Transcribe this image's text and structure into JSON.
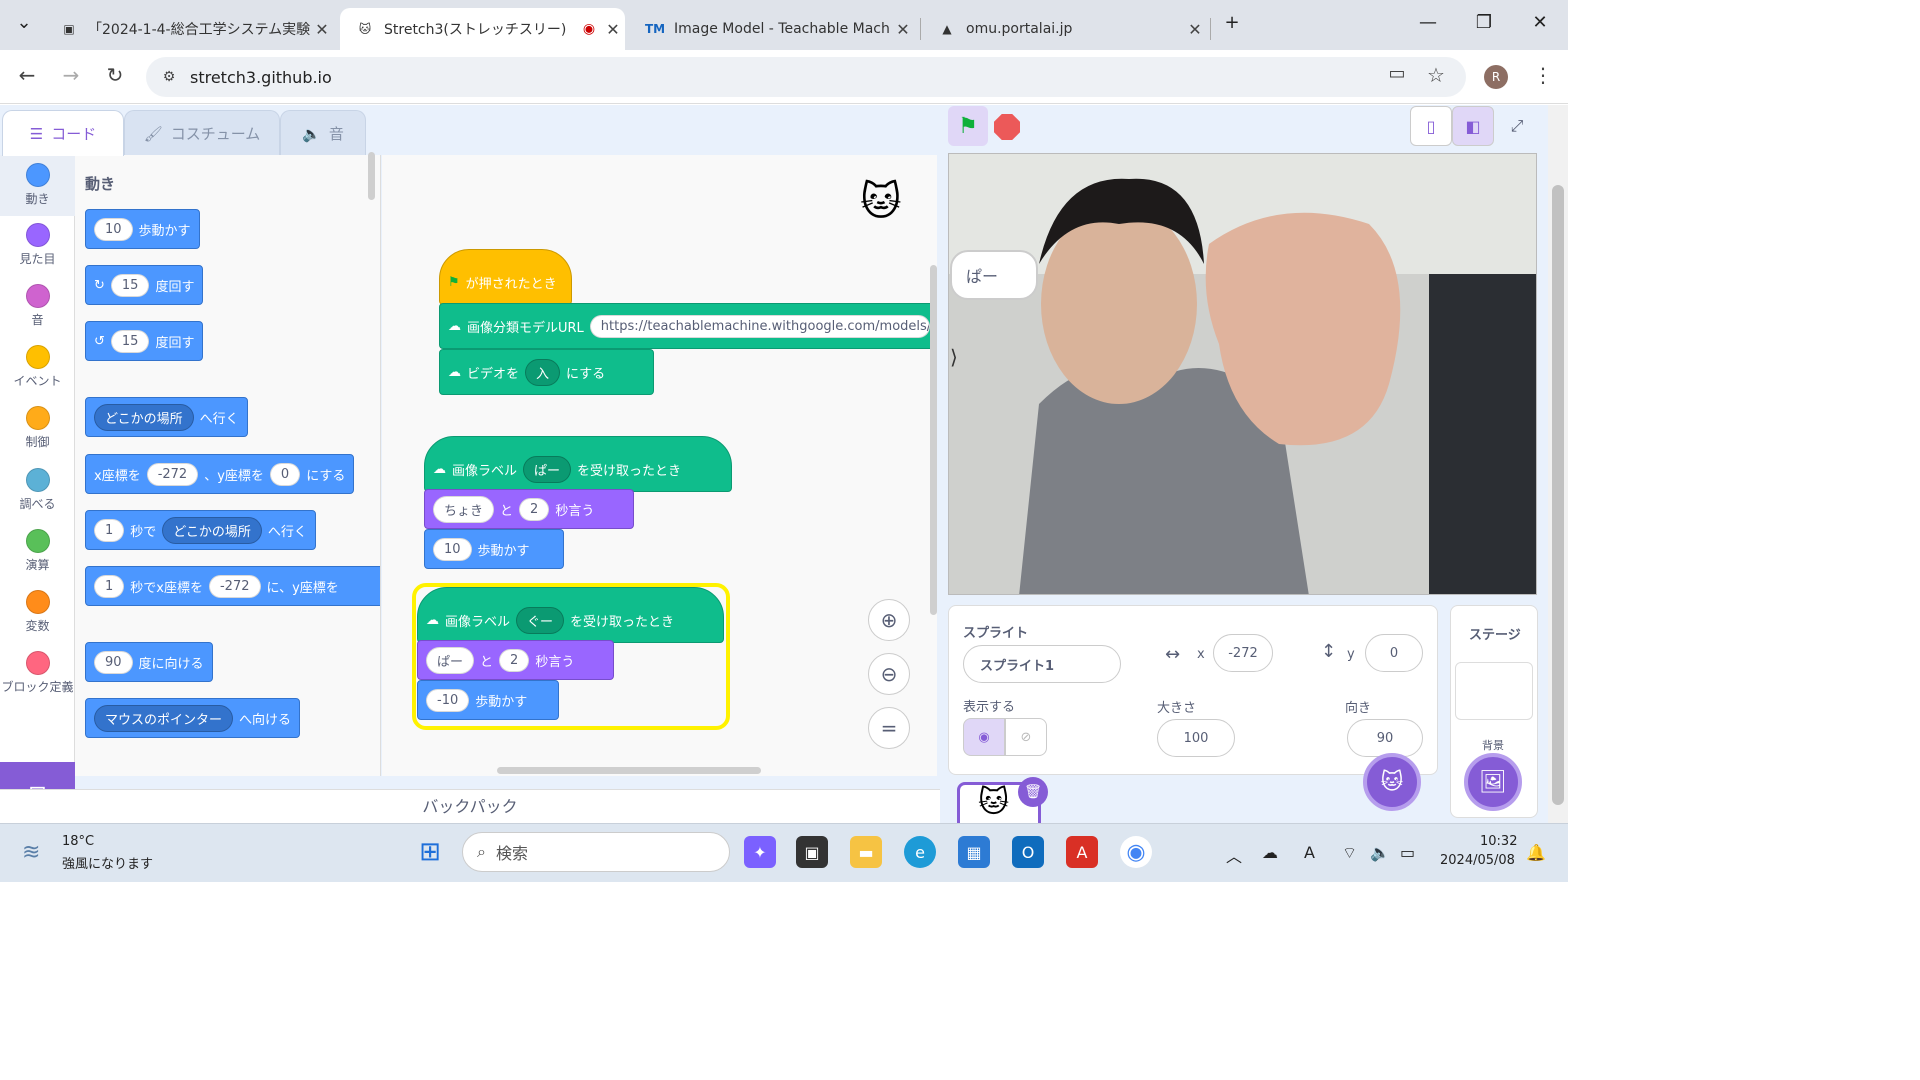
{
  "browser": {
    "tabs": [
      {
        "title": "「2024-1-4-総合工学システム実験",
        "icon": "doc-icon"
      },
      {
        "title": "Stretch3(ストレッチスリー)",
        "icon": "scratch-cat-icon",
        "active": true
      },
      {
        "title": "Image Model - Teachable Mach",
        "icon": "tm-icon"
      },
      {
        "title": "omu.portalai.jp",
        "icon": "triangle-logo-icon"
      }
    ],
    "url": "stretch3.github.io",
    "profile_initial": "R"
  },
  "editor": {
    "tabs": [
      "コード",
      "コスチューム",
      "音"
    ],
    "categories": [
      "動き",
      "見た目",
      "音",
      "イベント",
      "制御",
      "調べる",
      "演算",
      "変数",
      "ブロック定義"
    ],
    "category_colors": [
      "#4c97ff",
      "#9966ff",
      "#cf63cf",
      "#ffbf00",
      "#ffab19",
      "#5cb1d6",
      "#59c059",
      "#ff8c1a",
      "#ff6680"
    ],
    "palette_title": "動き",
    "palette": {
      "move_steps": "10",
      "move_steps_label": "歩動かす",
      "turn_right": "15",
      "turn_label": "度回す",
      "turn_left": "15",
      "goto_dd": "どこかの場所",
      "goto_label": "へ行く",
      "setxy_x_label": "x座標を",
      "setxy_x": "-272",
      "setxy_y_label": "、y座標を",
      "setxy_y": "0",
      "setxy_end": "にする",
      "glide_secs": "1",
      "glide_label": "秒で",
      "glide_dd": "どこかの場所",
      "glide_end": "へ行く",
      "glidexy_secs": "1",
      "glidexy_label": "秒でx座標を",
      "glidexy_x": "-272",
      "glidexy_mid": "に、y座標を",
      "point_dir": "90",
      "point_label": "度に向ける",
      "pointto_dd": "マウスのポインター",
      "pointto_label": "へ向ける"
    },
    "script1": {
      "hat": "が押されたとき",
      "model_label": "画像分類モデルURL",
      "model_url": "https://teachablemachine.withgoogle.com/models/tf",
      "video_label": "ビデオを",
      "video_dd": "入",
      "video_end": "にする"
    },
    "script2": {
      "hat_label": "画像ラベル",
      "hat_dd": "ぱー",
      "hat_end": "を受け取ったとき",
      "say_text": "ちょき",
      "say_to": "と",
      "say_secs": "2",
      "say_label": "秒言う",
      "move": "10",
      "move_label": "歩動かす"
    },
    "script3": {
      "hat_label": "画像ラベル",
      "hat_dd": "ぐー",
      "hat_end": "を受け取ったとき",
      "say_text": "ぱー",
      "say_to": "と",
      "say_secs": "2",
      "say_label": "秒言う",
      "move": "-10",
      "move_label": "歩動かす"
    },
    "backpack": "バックパック"
  },
  "stage": {
    "bubble": "ぱー"
  },
  "sprite_info": {
    "sprite_label": "スプライト",
    "sprite_name": "スプライト1",
    "x_label": "x",
    "x": "-272",
    "y_label": "y",
    "y": "0",
    "show_label": "表示する",
    "size_label": "大きさ",
    "size": "100",
    "dir_label": "向き",
    "dir": "90"
  },
  "stage_panel": {
    "title": "ステージ",
    "backdrop_label": "背景"
  },
  "taskbar": {
    "weather_temp": "18°C",
    "weather_text": "強風になります",
    "search_placeholder": "検索",
    "time": "10:32",
    "date": "2024/05/08"
  }
}
